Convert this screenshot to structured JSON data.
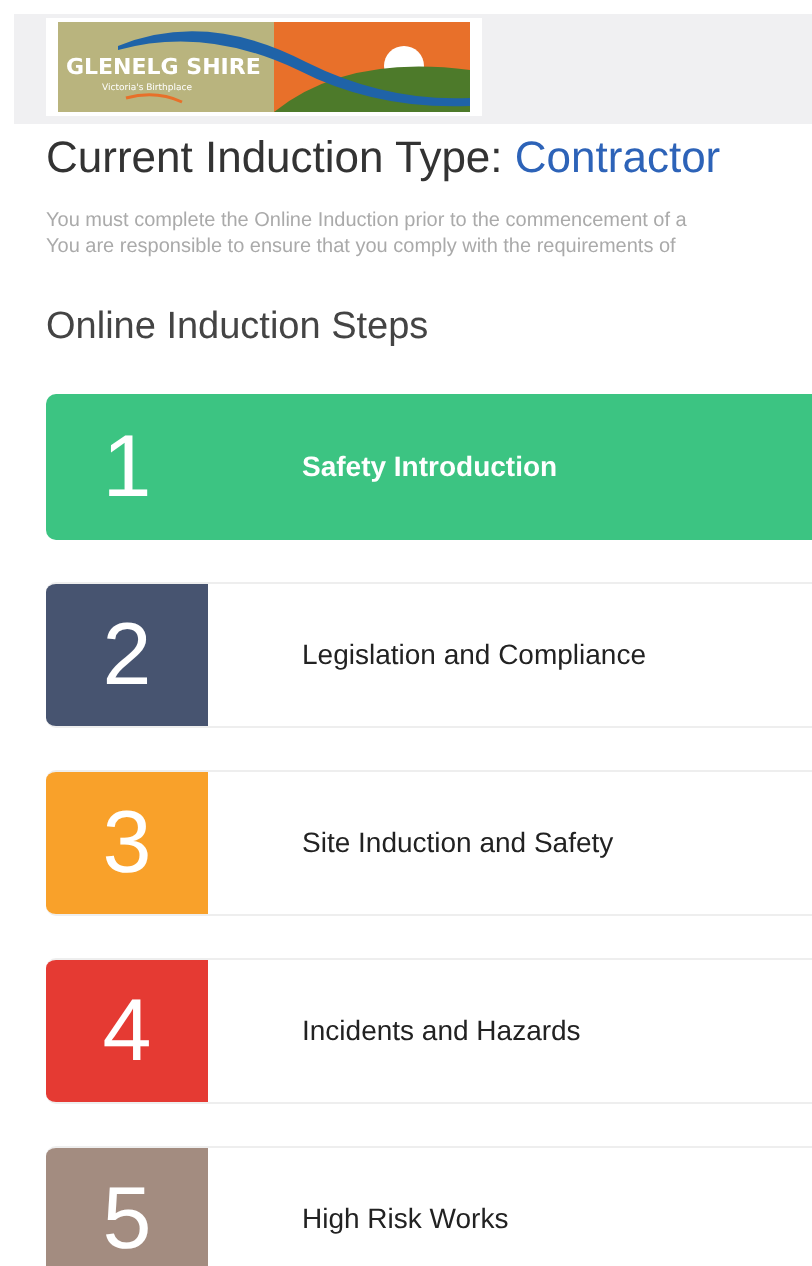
{
  "logo": {
    "name": "GLENELG SHIRE",
    "tagline": "Victoria's Birthplace"
  },
  "title": {
    "label": "Current Induction Type:",
    "value": "Contractor"
  },
  "intro": [
    "You must complete the Online Induction prior to the commencement of a",
    "You are responsible to ensure that you comply with the requirements of"
  ],
  "steps_heading": "Online Induction Steps",
  "steps": [
    {
      "number": "1",
      "label": "Safety Introduction",
      "selected": true,
      "color": "#3cc482"
    },
    {
      "number": "2",
      "label": "Legislation and Compliance",
      "selected": false,
      "color": "#475470"
    },
    {
      "number": "3",
      "label": "Site Induction and Safety",
      "selected": false,
      "color": "#f9a12a"
    },
    {
      "number": "4",
      "label": "Incidents and Hazards",
      "selected": false,
      "color": "#e53a33"
    },
    {
      "number": "5",
      "label": "High Risk Works",
      "selected": false,
      "color": "#a38c80"
    }
  ]
}
